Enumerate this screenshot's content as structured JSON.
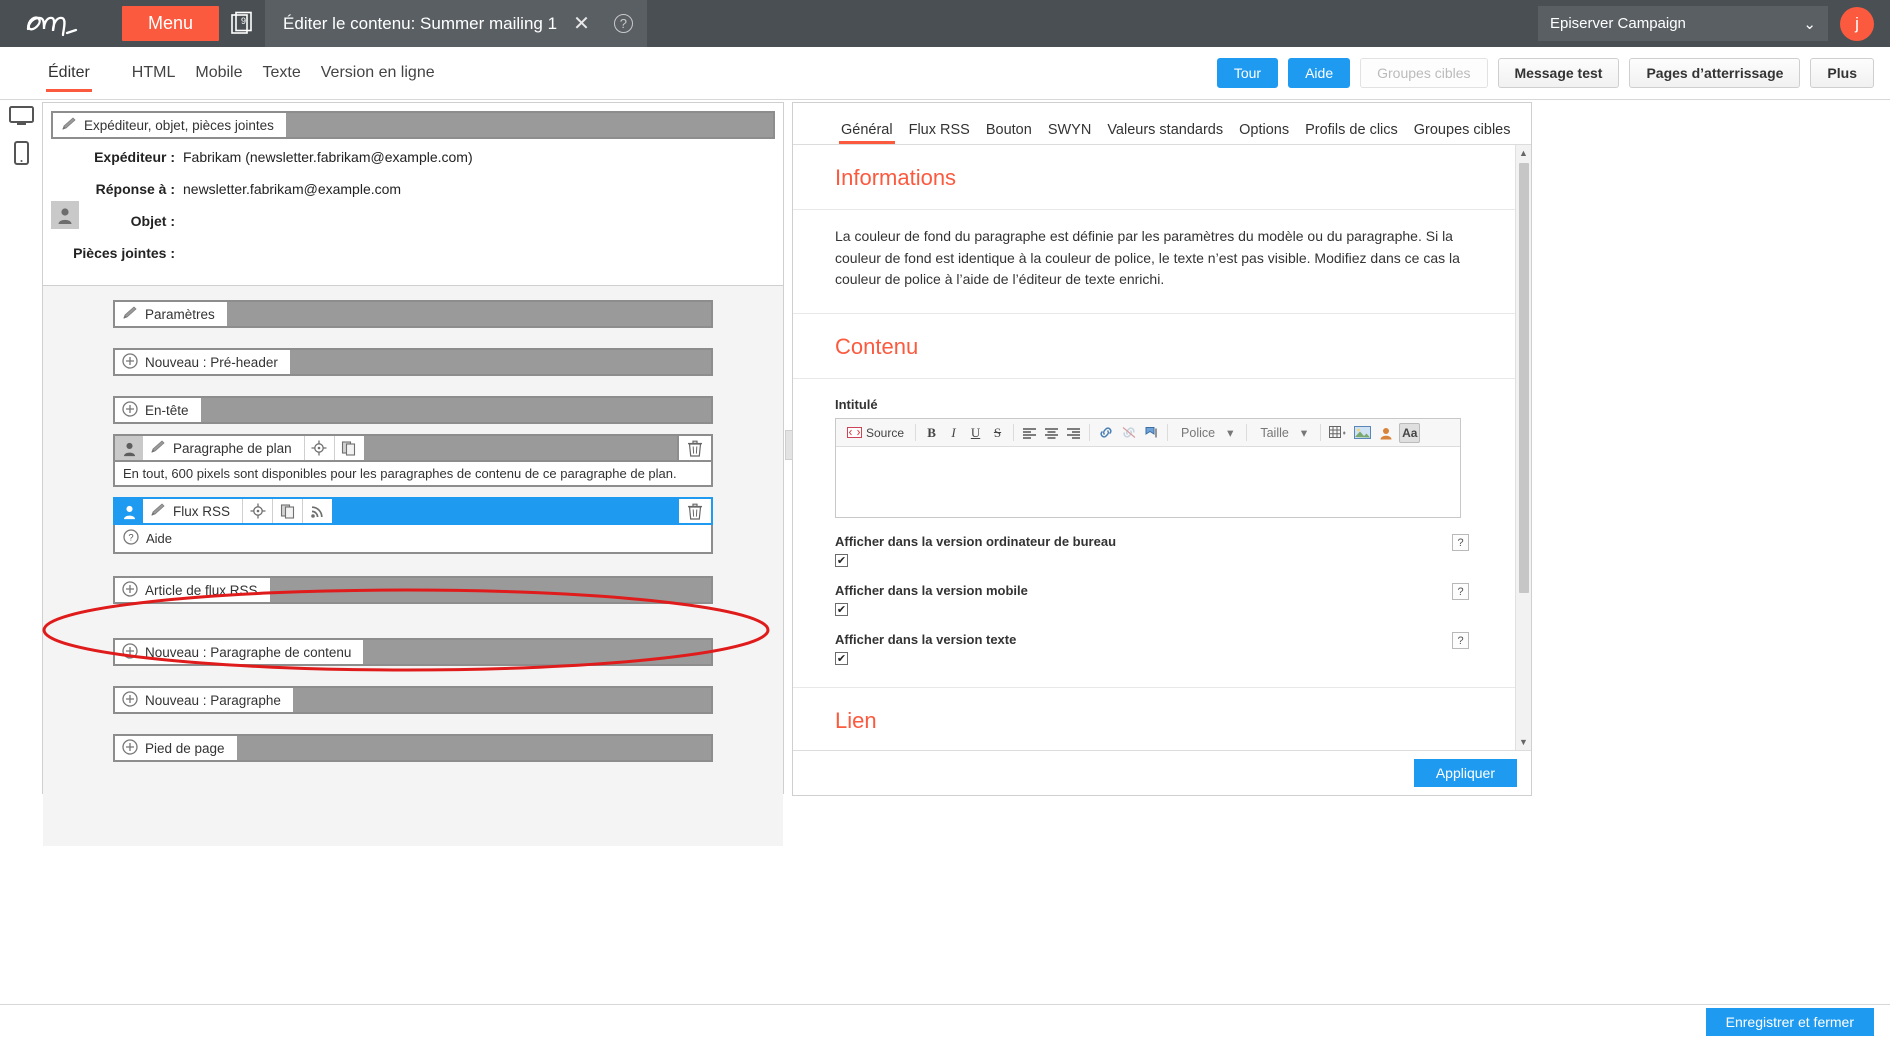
{
  "topbar": {
    "logo_alt": "episerver-logo",
    "menu_label": "Menu",
    "stack_badge": "9",
    "document_tab": "Éditer le contenu: Summer mailing 1",
    "close_label": "✕",
    "help_label": "?",
    "client_name": "Episerver Campaign",
    "chevron": "⌄",
    "avatar_initial": "j"
  },
  "viewbar": {
    "tabs": [
      {
        "label": "Éditer",
        "active": true
      },
      {
        "label": "HTML",
        "active": false
      },
      {
        "label": "Mobile",
        "active": false
      },
      {
        "label": "Texte",
        "active": false
      },
      {
        "label": "Version en ligne",
        "active": false
      }
    ],
    "actions": [
      {
        "label": "Tour",
        "style": "blue"
      },
      {
        "label": "Aide",
        "style": "blue"
      },
      {
        "label": "Groupes cibles",
        "style": "ghost"
      },
      {
        "label": "Message test",
        "style": "grey"
      },
      {
        "label": "Pages d’atterrissage",
        "style": "grey"
      },
      {
        "label": "Plus",
        "style": "grey"
      }
    ]
  },
  "left_rail": {
    "desktop_icon": "desktop-icon",
    "mobile_icon": "mobile-icon"
  },
  "editor": {
    "sender_strip_label": "Expéditeur, objet, pièces jointes",
    "rows": [
      {
        "label": "Expéditeur :",
        "value": "Fabrikam (newsletter.fabrikam@example.com)"
      },
      {
        "label": "Réponse à :",
        "value": "newsletter.fabrikam@example.com"
      },
      {
        "label": "Objet :",
        "value": ""
      },
      {
        "label": "Pièces jointes :",
        "value": ""
      }
    ],
    "nodes": [
      {
        "label": "Paramètres",
        "icon": "brush-icon",
        "type": "plain"
      },
      {
        "label": "Nouveau : Pré-header",
        "icon": "plus-icon",
        "type": "plain"
      },
      {
        "label": "En-tête",
        "icon": "plus-icon",
        "type": "plain"
      },
      {
        "label": "Paragraphe de plan",
        "icon": "brush-icon",
        "type": "block",
        "avatar": true,
        "tools": [
          "target-icon",
          "copy-icon"
        ],
        "trash": true,
        "sub": "En tout, 600 pixels sont disponibles pour les paragraphes de contenu de ce paragraphe de plan."
      },
      {
        "label": "Flux RSS",
        "icon": "brush-icon",
        "type": "block",
        "selected": true,
        "avatar": true,
        "tools": [
          "target-icon",
          "copy-icon",
          "rss-icon"
        ],
        "trash": true,
        "sub": "Aide",
        "sub_icon": "help-icon"
      },
      {
        "label": "Article de flux RSS",
        "icon": "plus-icon",
        "type": "plain"
      },
      {
        "label": "Nouveau : Paragraphe de contenu",
        "icon": "plus-icon",
        "type": "plain"
      },
      {
        "label": "Nouveau : Paragraphe",
        "icon": "plus-icon",
        "type": "plain"
      },
      {
        "label": "Pied de page",
        "icon": "plus-icon",
        "type": "plain"
      }
    ]
  },
  "panel": {
    "tabs": [
      {
        "label": "Général",
        "active": true
      },
      {
        "label": "Flux RSS",
        "active": false
      },
      {
        "label": "Bouton",
        "active": false
      },
      {
        "label": "SWYN",
        "active": false
      },
      {
        "label": "Valeurs standards",
        "active": false
      },
      {
        "label": "Options",
        "active": false
      },
      {
        "label": "Profils de clics",
        "active": false
      },
      {
        "label": "Groupes cibles",
        "active": false
      }
    ],
    "informations_title": "Informations",
    "informations_text": "La couleur de fond du paragraphe est définie par les paramètres du modèle ou du paragraphe. Si la couleur de fond est identique à la couleur de police, le texte n’est pas visible. Modifiez dans ce cas la couleur de police à l’aide de l’éditeur de texte enrichi.",
    "contenu_title": "Contenu",
    "field_label": "Intitulé",
    "rte": {
      "source_label": "Source",
      "bold": "B",
      "italic": "I",
      "underline": "U",
      "strike": "S",
      "align_left": "align-left-icon",
      "align_center": "align-center-icon",
      "align_right": "align-right-icon",
      "link": "link-icon",
      "unlink": "unlink-icon",
      "anchor": "anchor-icon",
      "font_label": "Police",
      "size_label": "Taille",
      "table": "table-icon",
      "image": "image-icon",
      "personalize": "personalization-icon",
      "format_aa": "Aa",
      "content_value": ""
    },
    "checkboxes": [
      {
        "label": "Afficher dans la version ordinateur de bureau",
        "checked": true,
        "help": "?"
      },
      {
        "label": "Afficher dans la version mobile",
        "checked": true,
        "help": "?"
      },
      {
        "label": "Afficher dans la version texte",
        "checked": true,
        "help": "?"
      }
    ],
    "lien_title": "Lien",
    "apply_label": "Appliquer"
  },
  "bottom": {
    "save_label": "Enregistrer et fermer"
  },
  "colors": {
    "accent_orange": "#fb5a3f",
    "accent_blue": "#1e9bf0",
    "topbar_grey": "#4a4f54",
    "annotation_red": "#e01b1b"
  }
}
